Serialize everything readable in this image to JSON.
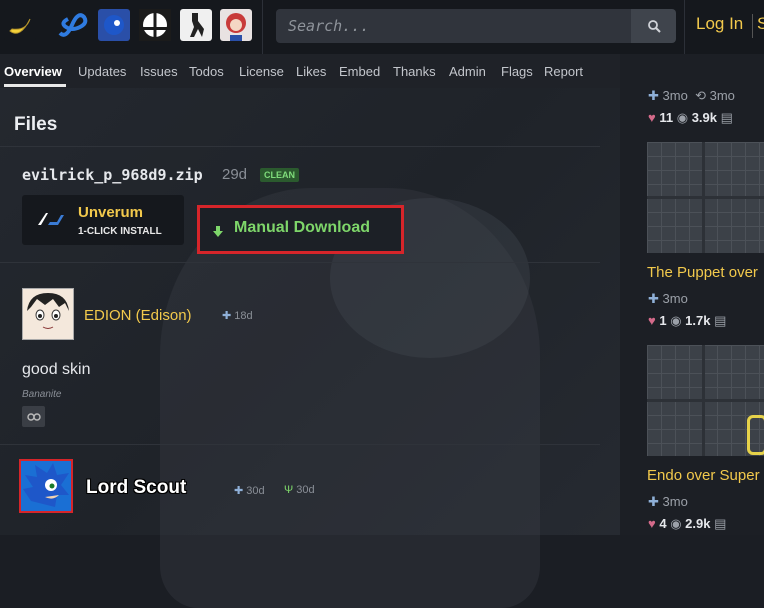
{
  "header": {
    "search_placeholder": "Search...",
    "login_label": "Log In",
    "login_trailing": "S",
    "game_icons": [
      "banana-icon",
      "infinity-icon",
      "sonic-game-icon",
      "smash-icon",
      "counter-strike-icon",
      "fnf-icon"
    ]
  },
  "tabs": [
    "Overview",
    "Updates",
    "Issues",
    "Todos",
    "License",
    "Likes",
    "Embed",
    "Thanks",
    "Admin",
    "Flags",
    "Report"
  ],
  "files": {
    "title": "Files",
    "file_name": "evilrick_p_968d9.zip",
    "age": "29d",
    "badge": "CLEAN",
    "installer_name": "Unverum",
    "installer_sub": "1-CLICK INSTALL",
    "manual_label": "Manual Download"
  },
  "comments": [
    {
      "author": "EDION (Edison)",
      "time": "18d",
      "text": "good skin",
      "sub": "Bananite"
    },
    {
      "author": "Lord Scout",
      "time_a": "30d",
      "time_b": "30d"
    }
  ],
  "sidebar": {
    "top_meta_a": "3mo",
    "top_meta_b": "3mo",
    "top_likes": "11",
    "top_views": "3.9k",
    "item1_title": "The Puppet over",
    "item1_age": "3mo",
    "item1_likes": "1",
    "item1_views": "1.7k",
    "item2_title": "Endo over Super",
    "item2_age": "3mo",
    "item2_likes": "4",
    "item2_views": "2.9k"
  },
  "colors": {
    "accent": "#f2c94c",
    "download_green": "#7ed66a",
    "highlight_red": "#d6252a"
  }
}
